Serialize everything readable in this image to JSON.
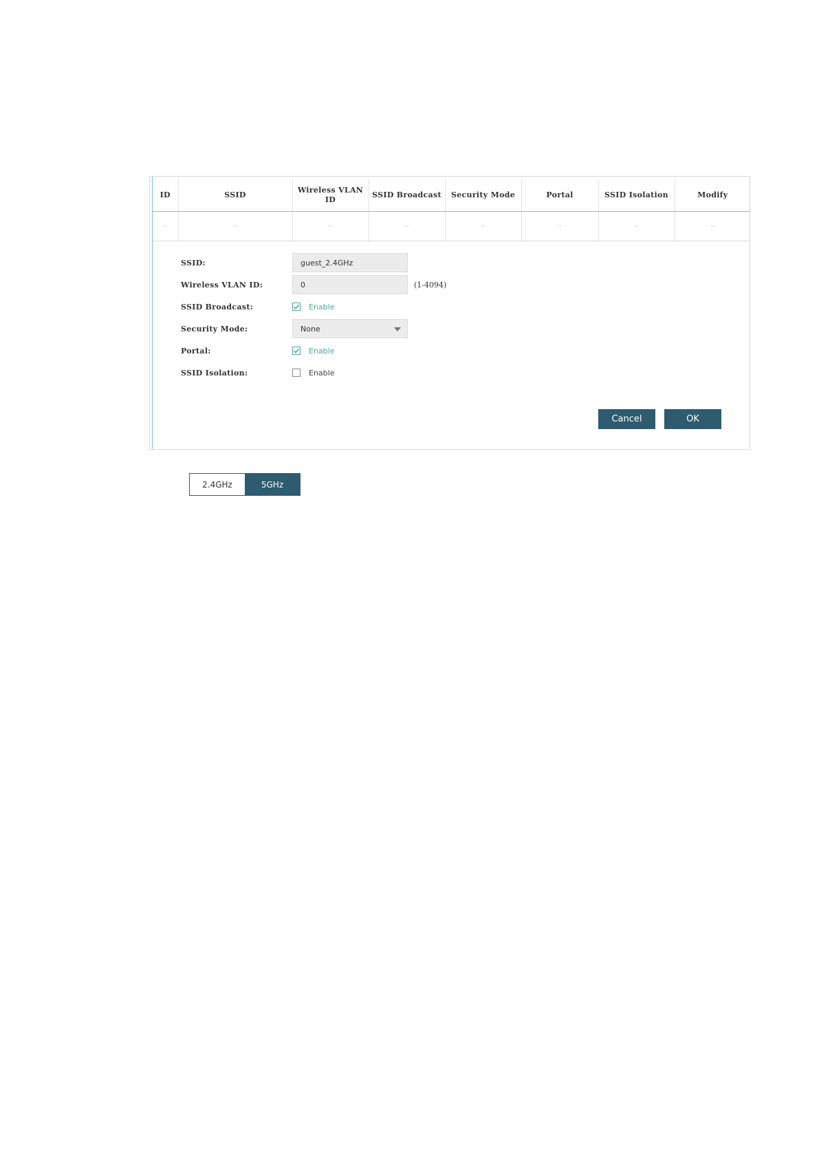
{
  "table": {
    "headers": [
      "ID",
      "SSID",
      "Wireless VLAN ID",
      "SSID Broadcast",
      "Security Mode",
      "Portal",
      "SSID Isolation",
      "Modify"
    ],
    "empty_row": [
      "--",
      "--",
      "--",
      "--",
      "--",
      "--",
      "--",
      "--"
    ]
  },
  "form": {
    "ssid": {
      "label": "SSID:",
      "value": "guest_2.4GHz"
    },
    "vlan": {
      "label": "Wireless VLAN ID:",
      "value": "0",
      "hint": "(1-4094)"
    },
    "broadcast": {
      "label": "SSID Broadcast:",
      "checkbox_label": "Enable",
      "checked": true
    },
    "security": {
      "label": "Security Mode:",
      "selected": "None"
    },
    "portal": {
      "label": "Portal:",
      "checkbox_label": "Enable",
      "checked": true
    },
    "isolation": {
      "label": "SSID Isolation:",
      "checkbox_label": "Enable",
      "checked": false
    }
  },
  "buttons": {
    "cancel": "Cancel",
    "ok": "OK"
  },
  "band_toggle": {
    "tabs": [
      "2.4GHz",
      "5GHz"
    ],
    "active": "5GHz"
  },
  "colors": {
    "accent": "#2e5b6f",
    "teal": "#4aa9a1",
    "input_bg": "#ececec"
  }
}
